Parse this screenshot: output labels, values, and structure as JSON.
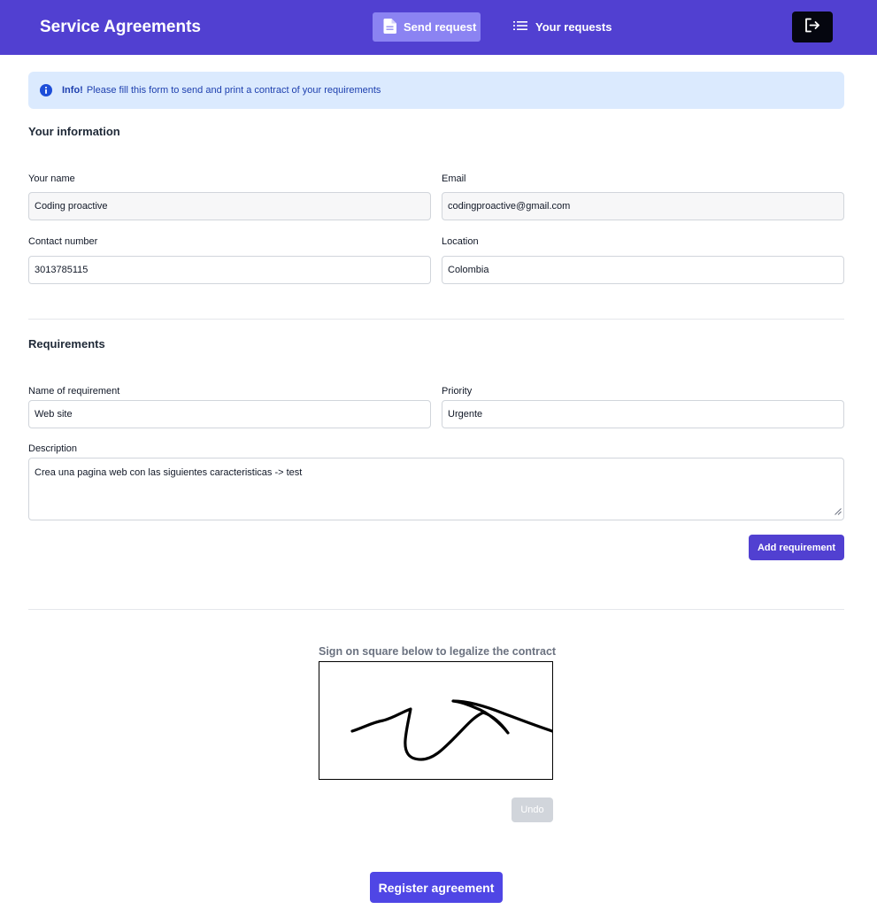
{
  "header": {
    "brand": "Service Agreements",
    "nav_send": "Send request",
    "nav_requests": "Your requests"
  },
  "alert": {
    "strong": "Info!",
    "text": "Please fill this form to send and print a contract of your requirements"
  },
  "your_information": {
    "title": "Your information",
    "name_label": "Your name",
    "name_value": "Coding proactive",
    "email_label": "Email",
    "email_value": "codingproactive@gmail.com",
    "contact_label": "Contact number",
    "contact_value": "3013785115",
    "location_label": "Location",
    "location_value": "Colombia"
  },
  "requirements": {
    "title": "Requirements",
    "name_label": "Name of requirement",
    "name_value": "Web site",
    "priority_label": "Priority",
    "priority_value": "Urgente",
    "description_label": "Description",
    "description_value": "Crea una pagina web con las siguientes caracteristicas -> test",
    "add_button": "Add requirement"
  },
  "signature": {
    "label": "Sign on square below to legalize the contract",
    "undo": "Undo"
  },
  "register_button": "Register agreement",
  "colors": {
    "primary": "#5140d1",
    "nav_active": "#8b83f2",
    "alert_bg": "#dbeafe",
    "alert_text": "#1e40af"
  },
  "icons": {
    "nav_send": "document-icon",
    "nav_requests": "list-icon",
    "logout": "logout-icon",
    "alert": "info-icon"
  }
}
